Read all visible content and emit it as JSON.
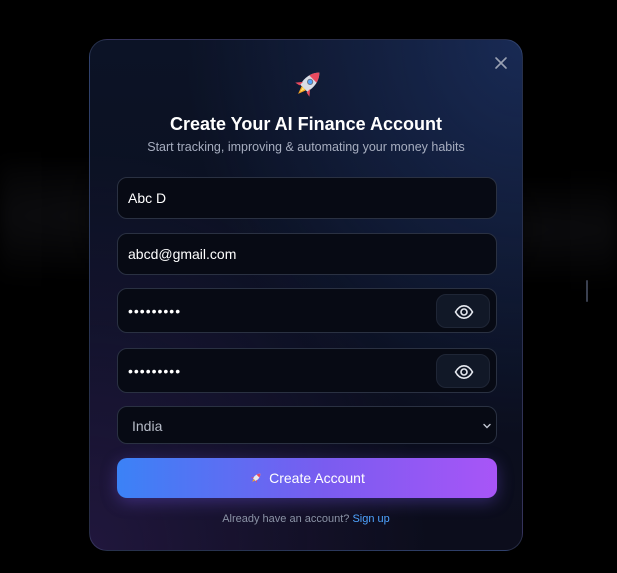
{
  "modal": {
    "title": "Create Your AI Finance Account",
    "subtitle": "Start tracking, improving & automating your money habits",
    "close_icon": "close-icon",
    "header_icon": "rocket-icon"
  },
  "form": {
    "name": {
      "value": "Abc D"
    },
    "email": {
      "value": "abcd@gmail.com"
    },
    "password": {
      "masked": "•••••••••",
      "toggle_icon": "eye-icon"
    },
    "confirm_password": {
      "masked": "•••••••••",
      "toggle_icon": "eye-icon"
    },
    "country": {
      "selected": "India",
      "chevron_icon": "chevron-down-icon"
    },
    "submit_label": "Create Account",
    "submit_icon": "rocket-icon"
  },
  "footer": {
    "prompt": "Already have an account?",
    "link": "Sign up"
  },
  "colors": {
    "button_gradient_start": "#3b82f6",
    "button_gradient_end": "#a855f7",
    "link": "#4ea3ff",
    "input_fill": "#e8effd"
  }
}
